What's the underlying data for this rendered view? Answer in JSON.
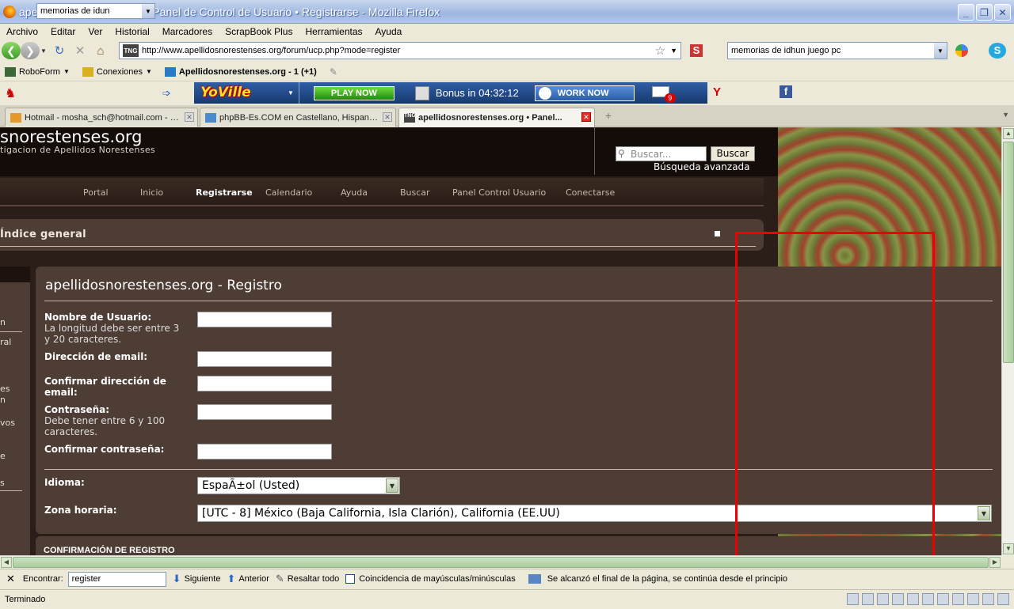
{
  "window": {
    "title": "apellidosnorestenses.org • Panel de Control de Usuario • Registrarse - Mozilla Firefox"
  },
  "menu": [
    "Archivo",
    "Editar",
    "Ver",
    "Historial",
    "Marcadores",
    "ScrapBook Plus",
    "Herramientas",
    "Ayuda"
  ],
  "navbar": {
    "url": "http://www.apellidosnorestenses.org/forum/ucp.php?mode=register",
    "site_icon_text": "TNG",
    "search_value": "memorias de idhun juego pc"
  },
  "bookmarks": [
    {
      "label": "RoboForm",
      "dropdown": true
    },
    {
      "label": "Conexiones",
      "dropdown": true
    },
    {
      "label": "Apellidosnorestenses.org - 1 (+1)",
      "dropdown": false
    }
  ],
  "addon": {
    "search_value": "memorias de idun",
    "yoville_label": "YoVille",
    "play_now": "PLAY NOW",
    "bonus": "Bonus in 04:32:12",
    "work_now": "WORK NOW",
    "mail_count": "9",
    "fb": "f",
    "y": "Y"
  },
  "tabs": [
    {
      "label": "Hotmail - mosha_sch@hotmail.com - Wi...",
      "active": false
    },
    {
      "label": "phpBB-Es.COM en Castellano, Hispano ...",
      "active": false
    },
    {
      "label": "apellidosnorestenses.org • Panel...",
      "active": true
    }
  ],
  "page": {
    "site_title": "snorestenses.org",
    "site_desc": "tigacion de Apellidos Norestenses",
    "search_placeholder": "Buscar...",
    "search_button": "Buscar",
    "advanced_search": "Búsqueda avanzada",
    "nav": [
      "Portal",
      "Inicio",
      "Registrarse",
      "Calendario",
      "Ayuda",
      "Buscar",
      "Panel Control Usuario",
      "Conectarse"
    ],
    "nav_current": "Registrarse",
    "breadcrumb": "Índice general",
    "sidebar_fragments": [
      "n",
      "ral",
      "es",
      "n",
      "vos",
      "e",
      "s"
    ],
    "register": {
      "title": "apellidosnorestenses.org - Registro",
      "username_label": "Nombre de Usuario:",
      "username_help": [
        "La longitud debe ser entre 3",
        "y 20 caracteres."
      ],
      "email_label": "Dirección de email:",
      "confirm_email_label": [
        "Confirmar dirección de",
        "email:"
      ],
      "password_label": "Contraseña:",
      "password_help": [
        "Debe tener entre 6 y 100",
        "caracteres."
      ],
      "confirm_password_label": "Confirmar contraseña:",
      "language_label": "Idioma:",
      "language_value": "EspaÃ±ol (Usted)",
      "timezone_label": "Zona horaria:",
      "timezone_value": "[UTC - 8] México (Baja California, Isla Clarión), California (EE.UU)"
    },
    "confirm_section": "CONFIRMACIÓN DE REGISTRO"
  },
  "findbar": {
    "label": "Encontrar:",
    "value": "register",
    "next": "Siguiente",
    "prev": "Anterior",
    "highlight": "Resaltar todo",
    "match_case": "Coincidencia de mayúsculas/minúsculas",
    "status": "Se alcanzó el final de la página, se continúa desde el principio"
  },
  "statusbar": {
    "text": "Terminado"
  },
  "colors": {
    "annotation": "#ee0000",
    "content_bg": "#4e3d34",
    "header_bg": "#140c09"
  }
}
